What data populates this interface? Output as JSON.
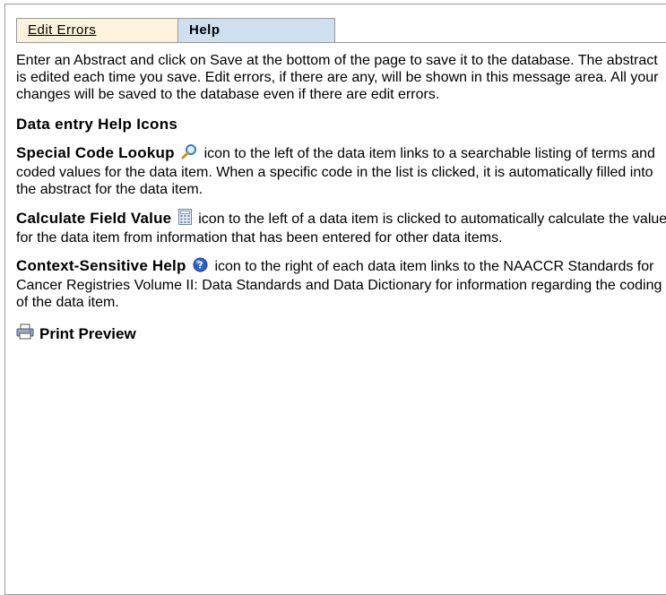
{
  "tabs": {
    "edit_errors": "Edit Errors",
    "help": "Help"
  },
  "intro": "Enter an Abstract and click on Save at the bottom of the page to save it to the database. The abstract is edited each time you save. Edit errors, if there are any, will be shown in this message area. All your changes will be saved to the database even if there are edit errors.",
  "heading": "Data entry Help Icons",
  "items": [
    {
      "term": "Special Code Lookup",
      "icon": "magnifier-icon",
      "text": "icon to the left of the data item links to a searchable listing of terms and coded values for the data item. When a specific code in the list is clicked, it is automatically filled into the abstract for the data item."
    },
    {
      "term": "Calculate Field Value",
      "icon": "calculator-icon",
      "text": "icon to the left of a data item is clicked to automatically calculate the value for the data item from information that has been entered for other data items."
    },
    {
      "term": "Context-Sensitive Help",
      "icon": "help-icon",
      "text": "icon to the right of each data item links to the NAACCR Standards for Cancer Registries Volume II: Data Standards and Data Dictionary for information regarding the coding of the data item."
    }
  ],
  "print_preview": "Print Preview",
  "colors": {
    "tab_edit_bg": "#fdf3dc",
    "tab_help_bg": "#cfe0f0",
    "border": "#9a9a9a"
  }
}
